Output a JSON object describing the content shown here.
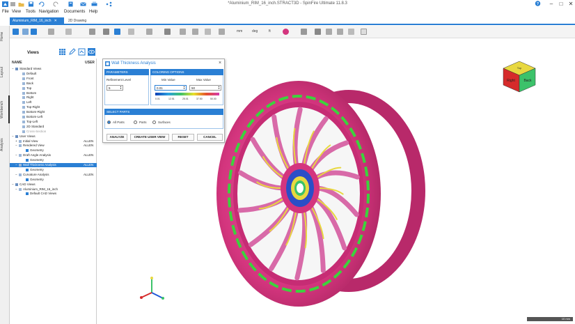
{
  "app": {
    "title": "*Aluminium_RIM_16_inch.STRACT3D - SpinFire Ultimate 11.8.3",
    "help_icon": "help-icon",
    "window_controls": [
      "–",
      "□",
      "✕"
    ]
  },
  "menu": [
    "File",
    "View",
    "Tools",
    "Navigation",
    "Documents",
    "Help"
  ],
  "tabs": [
    {
      "label": "Aluminium_RIM_16_inch",
      "close": "✕"
    },
    {
      "label": "2D Drawing"
    }
  ],
  "toolbar": {
    "unit_label": "mm",
    "angle_label": "deg",
    "filter_label": "ft"
  },
  "left_strip": [
    "Home",
    "Layout",
    "Workbench",
    "Analysis"
  ],
  "views_panel": {
    "title": "Views",
    "col_name": "NAME",
    "col_user": "USER",
    "rows": [
      {
        "label": "Standard Views",
        "user": "",
        "indent": 0,
        "expander": "−"
      },
      {
        "label": "Default",
        "user": "",
        "indent": 2
      },
      {
        "label": "Front",
        "user": "",
        "indent": 2
      },
      {
        "label": "Back",
        "user": "",
        "indent": 2
      },
      {
        "label": "Top",
        "user": "",
        "indent": 2
      },
      {
        "label": "Bottom",
        "user": "",
        "indent": 2
      },
      {
        "label": "Right",
        "user": "",
        "indent": 2
      },
      {
        "label": "Left",
        "user": "",
        "indent": 2
      },
      {
        "label": "Top-Right",
        "user": "",
        "indent": 2
      },
      {
        "label": "Bottom-Right",
        "user": "",
        "indent": 2
      },
      {
        "label": "Bottom-Left",
        "user": "",
        "indent": 2
      },
      {
        "label": "Top-Left",
        "user": "",
        "indent": 2
      },
      {
        "label": "2D Standard",
        "user": "",
        "indent": 2
      },
      {
        "label": "Cross-Section",
        "user": "",
        "indent": 2,
        "dim": true
      },
      {
        "label": "User Views",
        "user": "",
        "indent": 0,
        "expander": "−"
      },
      {
        "label": "Initial View",
        "user": "ALLEN",
        "indent": 1,
        "expander": "+"
      },
      {
        "label": "Rendered View",
        "user": "ALLEN",
        "indent": 1,
        "expander": "−"
      },
      {
        "label": "Geometry",
        "user": "",
        "indent": 3
      },
      {
        "label": "Draft Angle Analysis",
        "user": "ALLEN",
        "indent": 1,
        "expander": "−"
      },
      {
        "label": "Geometry",
        "user": "",
        "indent": 3
      },
      {
        "label": "Wall Thickness Analysis",
        "user": "ALLEN",
        "indent": 1,
        "expander": "−",
        "selected": true
      },
      {
        "label": "Geometry",
        "user": "",
        "indent": 3
      },
      {
        "label": "Curvature Analysis",
        "user": "ALLEN",
        "indent": 1,
        "expander": "−"
      },
      {
        "label": "Geometry",
        "user": "",
        "indent": 3
      },
      {
        "label": "CAD Views",
        "user": "",
        "indent": 0,
        "expander": "−"
      },
      {
        "label": "Aluminium_RIM_16_inch",
        "user": "",
        "indent": 1,
        "expander": "−"
      },
      {
        "label": "Default CAD Views",
        "user": "",
        "indent": 3
      }
    ]
  },
  "dialog": {
    "title": "Wall Thickness Analysis",
    "close": "×",
    "params_head": "PARAMETERS",
    "refinement_label": "Refinement Level",
    "refinement_value": "5",
    "coloring_head": "COLORING OPTIONS",
    "min_label": "Min Value",
    "max_label": "Max Value",
    "min_value": "0.01",
    "max_value": "50",
    "ramp_labels": [
      "0.01",
      "12.51",
      "25.01",
      "37.50",
      "50.00"
    ],
    "select_head": "SELECT PARTS",
    "options": [
      "All Parts",
      "Parts",
      "Surfaces"
    ],
    "selected_option": "All Parts",
    "buttons": [
      "ANALYZE",
      "CREATE USER VIEW",
      "RESET",
      "CANCEL"
    ]
  },
  "view_cube": {
    "top": "Top",
    "front": "Right",
    "side": "Back"
  },
  "status": {
    "scale": "10 mm"
  },
  "colors": {
    "accent": "#2a7fd4",
    "rim_base": "#d4357e",
    "rim_edge": "#3dd23d"
  }
}
